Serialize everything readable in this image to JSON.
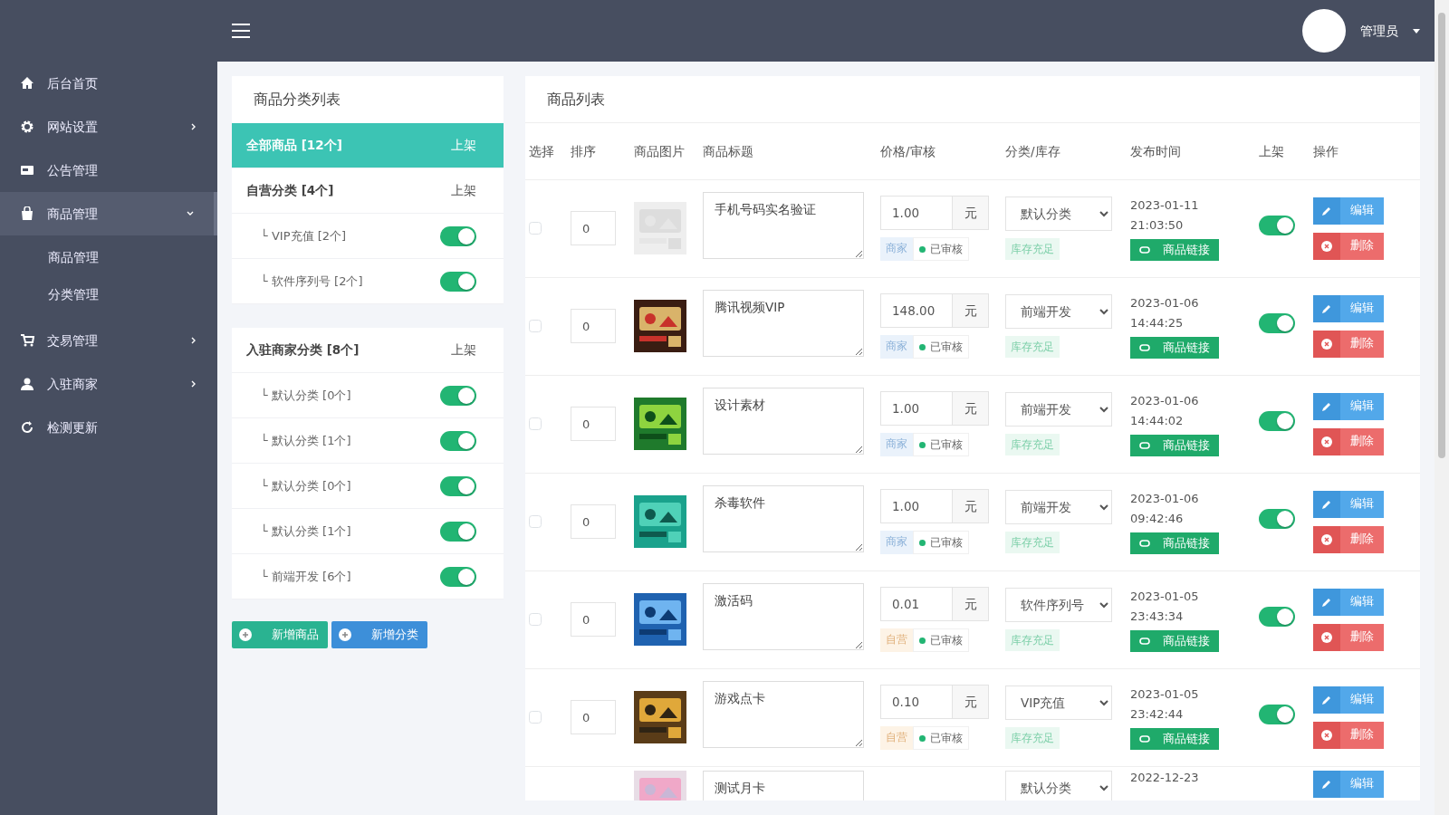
{
  "topbar": {
    "user": {
      "name": "管理员"
    }
  },
  "sidebar": {
    "items": [
      {
        "label": "后台首页",
        "selected": false
      },
      {
        "label": "网站设置",
        "selected": false,
        "expanded": false
      },
      {
        "label": "公告管理",
        "selected": false
      },
      {
        "label": "商品管理",
        "selected": true,
        "expanded": true,
        "children": [
          {
            "label": "商品管理",
            "selected": false
          },
          {
            "label": "分类管理",
            "selected": false
          }
        ]
      },
      {
        "label": "交易管理",
        "selected": false,
        "expanded": false
      },
      {
        "label": "入驻商家",
        "selected": false,
        "expanded": false
      },
      {
        "label": "检测更新",
        "selected": false
      }
    ]
  },
  "category_panel": {
    "title": "商品分类列表",
    "groups": [
      {
        "label": "全部商品 [12个]",
        "status_label": "上架",
        "selected": true
      },
      {
        "label": "自营分类 [4个]",
        "status_label": "上架",
        "selected": false,
        "children": [
          {
            "label": "└ VIP充值 [2个]",
            "on": true
          },
          {
            "label": "└ 软件序列号 [2个]",
            "on": true
          }
        ]
      },
      {
        "label": "入驻商家分类 [8个]",
        "status_label": "上架",
        "selected": false,
        "children": [
          {
            "label": "└ 默认分类 [0个]",
            "on": true
          },
          {
            "label": "└ 默认分类 [1个]",
            "on": true
          },
          {
            "label": "└ 默认分类 [0个]",
            "on": true
          },
          {
            "label": "└ 默认分类 [1个]",
            "on": true
          },
          {
            "label": "└ 前端开发 [6个]",
            "on": true
          }
        ]
      }
    ],
    "buttons": [
      {
        "label": "新增商品",
        "kind": "success"
      },
      {
        "label": "新增分类",
        "kind": "primary"
      }
    ]
  },
  "product_panel": {
    "title": "商品列表",
    "columns": [
      "选择",
      "排序",
      "商品图片",
      "商品标题",
      "价格/审核",
      "分类/库存",
      "发布时间",
      "上架",
      "操作"
    ],
    "rows": [
      {
        "checked": false,
        "sort": "0",
        "title": "手机号码实名验证",
        "price": "1.00",
        "unit": "元",
        "seller": {
          "label": "商家",
          "kind": "merchant"
        },
        "audit": "已审核",
        "category": "默认分类",
        "stock": "库存充足",
        "date": "2023-01-11",
        "time": "21:03:50",
        "link": "商品链接",
        "listed": true,
        "edit": "编辑",
        "delete": "删除"
      },
      {
        "checked": false,
        "sort": "0",
        "title": "腾讯视频VIP",
        "price": "148.00",
        "unit": "元",
        "seller": {
          "label": "商家",
          "kind": "merchant"
        },
        "audit": "已审核",
        "category": "前端开发",
        "stock": "库存充足",
        "date": "2023-01-06",
        "time": "14:44:25",
        "link": "商品链接",
        "listed": true,
        "edit": "编辑",
        "delete": "删除"
      },
      {
        "checked": false,
        "sort": "0",
        "title": "设计素材",
        "price": "1.00",
        "unit": "元",
        "seller": {
          "label": "商家",
          "kind": "merchant"
        },
        "audit": "已审核",
        "category": "前端开发",
        "stock": "库存充足",
        "date": "2023-01-06",
        "time": "14:44:02",
        "link": "商品链接",
        "listed": true,
        "edit": "编辑",
        "delete": "删除"
      },
      {
        "checked": false,
        "sort": "0",
        "title": "杀毒软件",
        "price": "1.00",
        "unit": "元",
        "seller": {
          "label": "商家",
          "kind": "merchant"
        },
        "audit": "已审核",
        "category": "前端开发",
        "stock": "库存充足",
        "date": "2023-01-06",
        "time": "09:42:46",
        "link": "商品链接",
        "listed": true,
        "edit": "编辑",
        "delete": "删除"
      },
      {
        "checked": false,
        "sort": "0",
        "title": "激活码",
        "price": "0.01",
        "unit": "元",
        "seller": {
          "label": "自营",
          "kind": "self"
        },
        "audit": "已审核",
        "category": "软件序列号",
        "stock": "库存充足",
        "date": "2023-01-05",
        "time": "23:43:34",
        "link": "商品链接",
        "listed": true,
        "edit": "编辑",
        "delete": "删除"
      },
      {
        "checked": false,
        "sort": "0",
        "title": "游戏点卡",
        "price": "0.10",
        "unit": "元",
        "seller": {
          "label": "自营",
          "kind": "self"
        },
        "audit": "已审核",
        "category": "VIP充值",
        "stock": "库存充足",
        "date": "2023-01-05",
        "time": "23:42:44",
        "link": "商品链接",
        "listed": true,
        "edit": "编辑",
        "delete": "删除"
      },
      {
        "title": "测试月卡",
        "category": "默认分类",
        "date": "2022-12-23",
        "edit": "编辑"
      }
    ]
  }
}
